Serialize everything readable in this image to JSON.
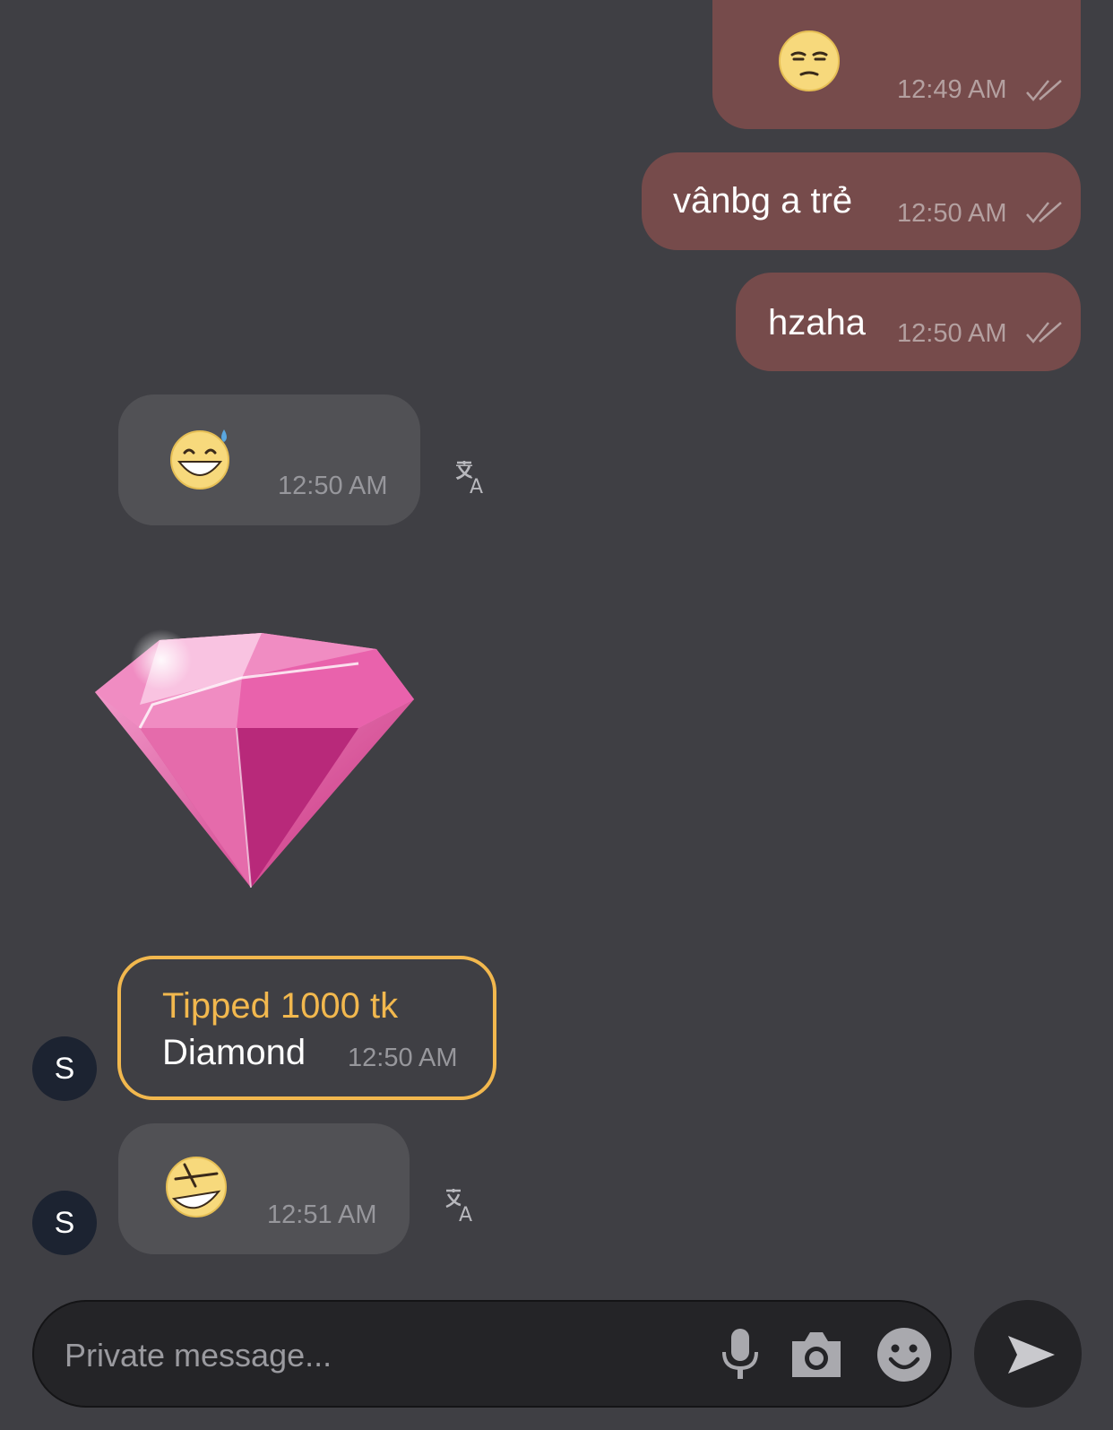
{
  "messages_out": [
    {
      "type": "emoji",
      "emoji": "unamused-face-emoji",
      "time": "12:49 AM",
      "status": "read"
    },
    {
      "type": "text",
      "text": "vânbg a trẻ",
      "time": "12:50 AM",
      "status": "read"
    },
    {
      "type": "text",
      "text": "hzaha",
      "time": "12:50 AM",
      "status": "read"
    }
  ],
  "messages_in": [
    {
      "type": "emoji",
      "emoji": "grinning-sweat-emoji",
      "time": "12:50 AM"
    },
    {
      "type": "gift",
      "gift_icon": "pink-diamond",
      "tip_title": "Tipped 1000 tk",
      "gift_name": "Diamond",
      "time": "12:50 AM",
      "avatar_initial": "S"
    },
    {
      "type": "emoji",
      "emoji": "laughing-crossed-eyes-emoji",
      "time": "12:51 AM",
      "avatar_initial": "S"
    }
  ],
  "composer": {
    "placeholder": "Private message...",
    "icons": [
      "microphone-icon",
      "camera-icon",
      "smiley-icon",
      "send-icon"
    ]
  },
  "colors": {
    "background": "#3f3f44",
    "outgoing_bubble": "#764b4b",
    "incoming_bubble": "#515155",
    "tip_accent": "#f2b84e",
    "avatar": "#1c2331"
  }
}
